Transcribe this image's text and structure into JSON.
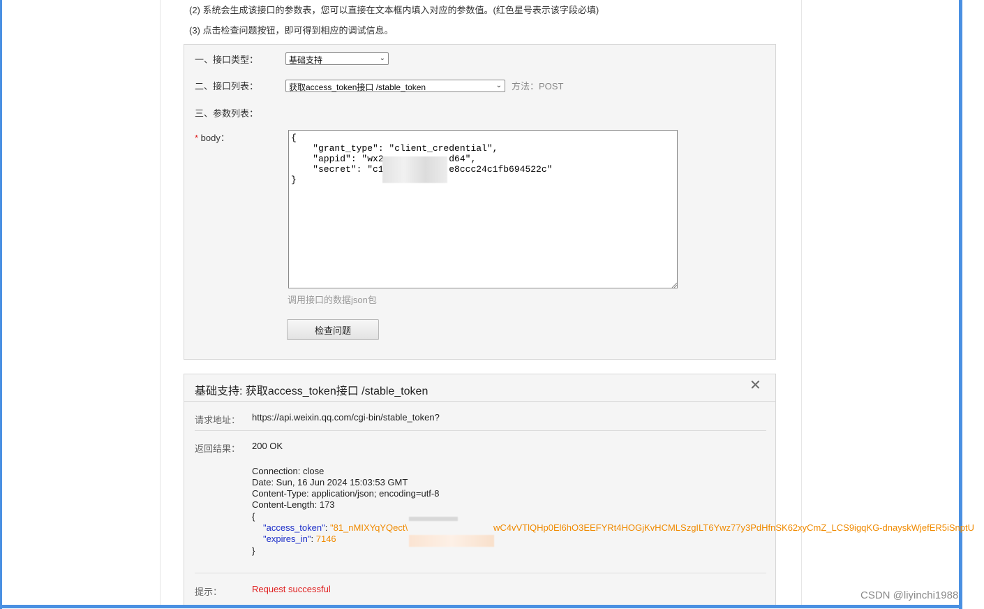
{
  "instructions": {
    "step2": "(2) 系统会生成该接口的参数表，您可以直接在文本框内填入对应的参数值。(红色星号表示该字段必填)",
    "step3": "(3) 点击检查问题按钮，即可得到相应的调试信息。"
  },
  "form": {
    "type_label": "一、接口类型：",
    "type_value": "基础支持",
    "list_label": "二、接口列表：",
    "list_value": "获取access_token接口 /stable_token",
    "method_text": "方法：POST",
    "params_label": "三、参数列表：",
    "required_mark": "*",
    "body_label": " body：",
    "body_lines": [
      "{",
      "    \"grant_type\": \"client_credential\",",
      "    \"appid\": \"wx2            d64\",",
      "    \"secret\": \"c1            e8ccc24c1fb694522c\"",
      "}"
    ],
    "body_hint": "调用接口的数据json包",
    "check_button": "检查问题"
  },
  "result": {
    "title": "基础支持: 获取access_token接口 /stable_token",
    "close_glyph": "✕",
    "request_label": "请求地址：",
    "request_url": "https://api.weixin.qq.com/cgi-bin/stable_token?",
    "return_label": "返回结果：",
    "status": "200 OK",
    "headers": [
      "Connection: close",
      "Date: Sun, 16 Jun 2024 15:03:53 GMT",
      "Content-Type: application/json; encoding=utf-8",
      "Content-Length: 173"
    ],
    "open_brace": "{",
    "token_key": "\"access_token\"",
    "token_val_a": "\"81_nMIXYqYQect\\",
    "token_val_b": "wC4vVTlQHp0El6hO3EEFYRt4HOGjKvHCMLSzgILT6Ywz77y3PdHfnSK62xyCmZ_LCS9igqKG-dnayskWjefER5iSnptU",
    "expires_key": "\"expires_in\"",
    "expires_val": "7146",
    "close_brace": "}",
    "tip_label": "提示：",
    "tip_value": "Request successful"
  },
  "watermark": "CSDN @liyinchi1988",
  "colors": {
    "frame": "#4a90e2",
    "key": "#1d2fc9",
    "value": "#f08a00",
    "success": "#e02020"
  }
}
